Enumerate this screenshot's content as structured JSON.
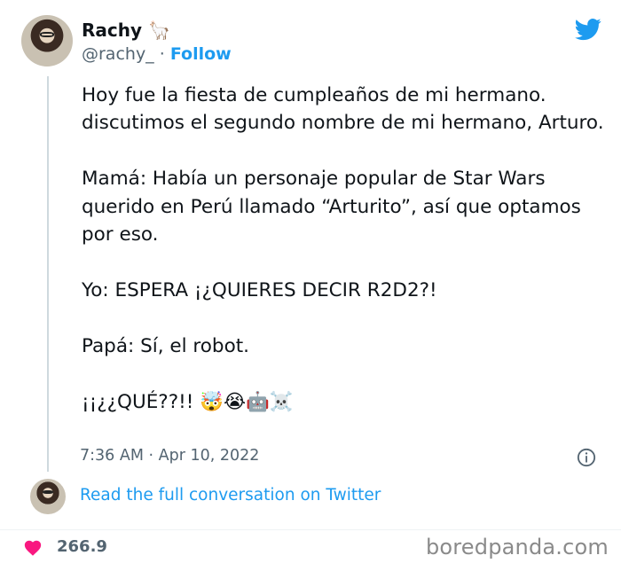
{
  "author": {
    "display_name": "Rachy 🦙",
    "handle": "@rachy_",
    "separator": " · ",
    "follow_label": "Follow"
  },
  "icons": {
    "platform": "twitter-bird-icon",
    "info": "info-icon",
    "like": "heart-icon"
  },
  "colors": {
    "accent": "#1d9bf0",
    "muted": "#536471",
    "like": "#f91880",
    "thread_line": "#cfd9de"
  },
  "tweet": {
    "paragraphs": [
      "Hoy fue la fiesta de cumpleaños de mi hermano. discutimos el segundo nombre de mi hermano, Arturo.",
      "Mamá: Había un personaje popular de Star Wars querido en Perú llamado “Arturito”, así que optamos por eso.",
      "Yo: ESPERA ¡¿QUIERES DECIR R2D2?!",
      "Papá: Sí, el robot.",
      "¡¡¿¿QUÉ??!! 🤯😭🤖☠️"
    ],
    "timestamp": "7:36 AM · Apr 10, 2022"
  },
  "conversation_link": "Read the full conversation on Twitter",
  "likes": "266.9",
  "watermark": "boredpanda.com"
}
